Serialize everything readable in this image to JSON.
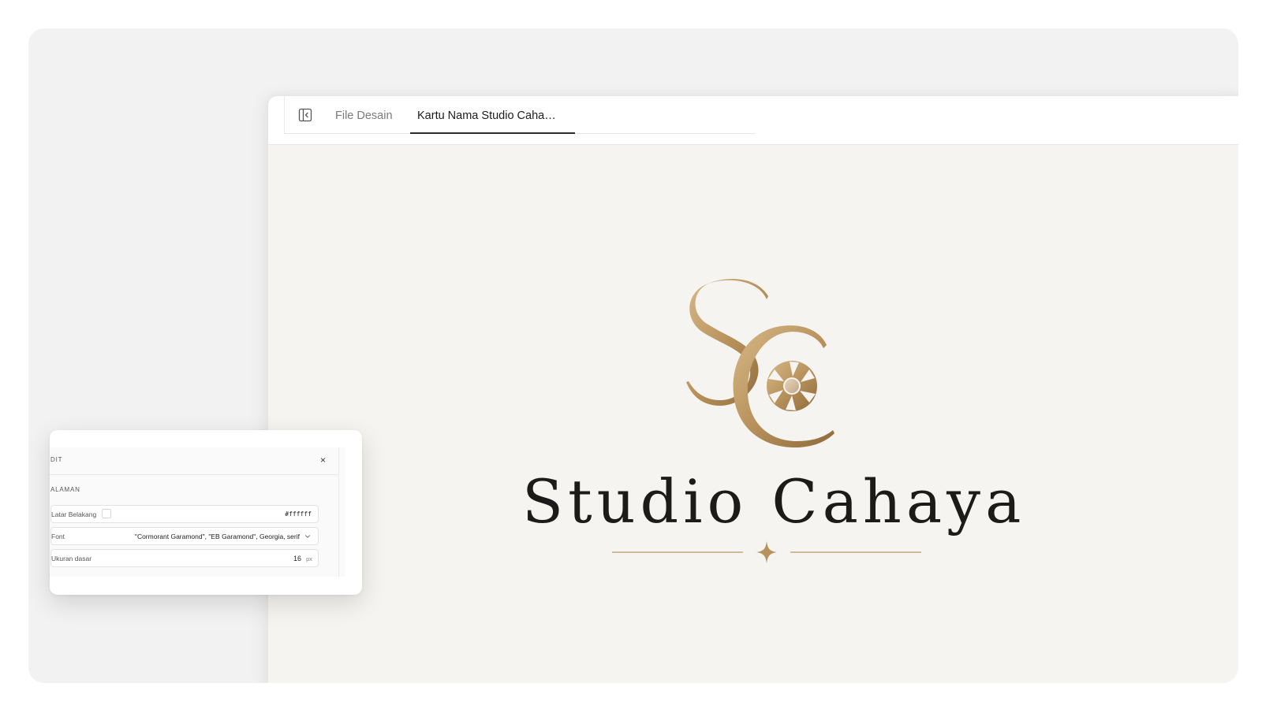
{
  "tabs": {
    "files_label": "File Desain",
    "active_label": "Kartu Nama Studio Caha…"
  },
  "design": {
    "monogram": "SC",
    "brand_name": "Studio Cahaya",
    "colors": {
      "gold": "#b08d57",
      "gold_light": "#d4b483",
      "ink": "#1d1b19",
      "canvas": "#f6f4f0"
    },
    "icons": [
      "camera-aperture-icon",
      "four-point-star-icon"
    ]
  },
  "properties_panel": {
    "title": "DIT",
    "close_label": "×",
    "section_label": "ALAMAN",
    "background_label": "Latar Belakang",
    "background_value": "#ffffff",
    "font_label": "Font",
    "font_value": "\"Cormorant Garamond\", \"EB Garamond\", Georgia, serif",
    "base_size_label": "Ukuran dasar",
    "base_size_value": "16",
    "base_size_unit": "px"
  }
}
